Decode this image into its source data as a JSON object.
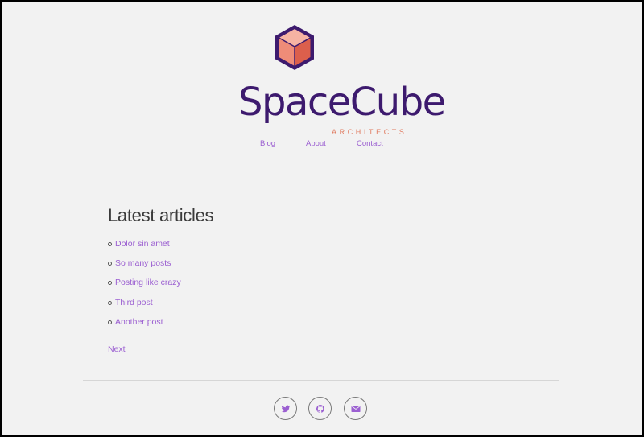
{
  "brand": {
    "name": "SpaceCube",
    "tagline": "ARCHITECTS",
    "colors": {
      "primary": "#3d1a6e",
      "accent": "#e07a5f",
      "link": "#9b5fd1"
    }
  },
  "nav": {
    "items": [
      {
        "label": "Blog"
      },
      {
        "label": "About"
      },
      {
        "label": "Contact"
      }
    ]
  },
  "main": {
    "heading": "Latest articles",
    "articles": [
      {
        "title": "Dolor sin amet"
      },
      {
        "title": "So many posts"
      },
      {
        "title": "Posting like crazy"
      },
      {
        "title": "Third post"
      },
      {
        "title": "Another post"
      }
    ],
    "pagination": {
      "next_label": "Next"
    }
  },
  "footer": {
    "social": [
      {
        "icon": "twitter-icon"
      },
      {
        "icon": "github-icon"
      },
      {
        "icon": "envelope-icon"
      }
    ]
  }
}
